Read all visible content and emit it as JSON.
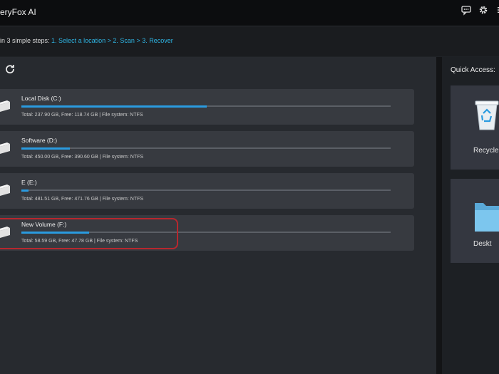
{
  "app": {
    "title": "eryFox AI"
  },
  "toolbar": {
    "icons": [
      "chat-icon",
      "gear-icon",
      "menu-icon"
    ]
  },
  "steps": {
    "prefix": "in 3 simple steps:",
    "step1": "1. Select a location",
    "sep1": ">",
    "step2": "2. Scan",
    "sep2": ">",
    "step3": "3. Recover"
  },
  "drives": [
    {
      "name": "Local Disk (C:)",
      "info": "Total: 237.90 GB, Free: 118.74 GB | File system: NTFS",
      "used_fraction": 0.501
    },
    {
      "name": "Software (D:)",
      "info": "Total: 450.00 GB, Free: 390.60 GB | File system: NTFS",
      "used_fraction": 0.132
    },
    {
      "name": "E (E:)",
      "info": "Total: 481.51 GB, Free: 471.76 GB | File system: NTFS",
      "used_fraction": 0.02
    },
    {
      "name": "New Volume (F:)",
      "info": "Total: 58.59 GB, Free: 47.78 GB | File system: NTFS",
      "used_fraction": 0.184
    }
  ],
  "quick_access": {
    "title": "Quick Access:",
    "items": [
      {
        "label": "Recycle",
        "icon": "recycle-bin-icon"
      },
      {
        "label": "Deskt",
        "icon": "folder-icon"
      }
    ]
  },
  "colors": {
    "accent": "#2fb7e6",
    "progress": "#2a9be0",
    "highlight": "#b8272e"
  }
}
